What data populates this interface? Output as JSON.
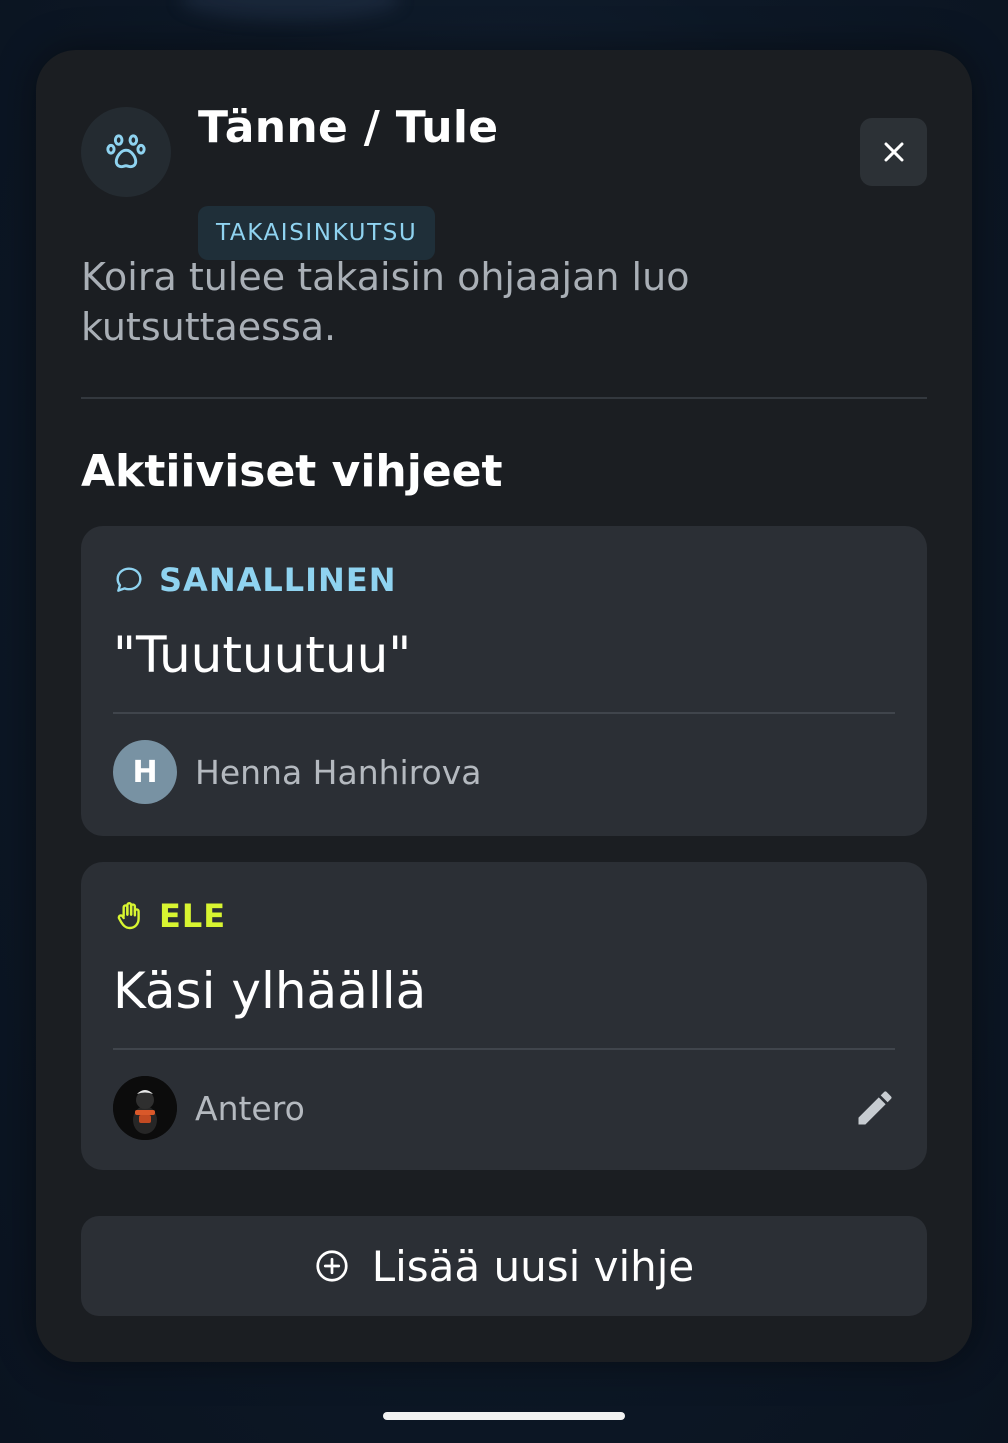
{
  "modal": {
    "title": "Tänne / Tule",
    "category": "TAKAISINKUTSU",
    "description": "Koira tulee takaisin ohjaajan luo kutsuttaessa.",
    "header_icon": "paw-icon",
    "close_icon": "close-icon"
  },
  "section": {
    "title": "Aktiiviset vihjeet"
  },
  "cues": [
    {
      "type_label": "SANALLINEN",
      "type_icon": "speech-bubble-icon",
      "type_color": "#8fd3f0",
      "text": "\"Tuutuutuu\"",
      "author_initial": "H",
      "author_avatar_color": "#7892a3",
      "author_name": "Henna Hanhirova"
    },
    {
      "type_label": "ELE",
      "type_icon": "hand-icon",
      "type_color": "#d8f531",
      "text": "Käsi ylhäällä",
      "author_avatar": "dog-photo-avatar",
      "author_name": "Antero",
      "edit_icon": "pencil-icon"
    }
  ],
  "add_button": {
    "label": "Lisää uusi vihje",
    "icon": "plus-circle-icon"
  }
}
